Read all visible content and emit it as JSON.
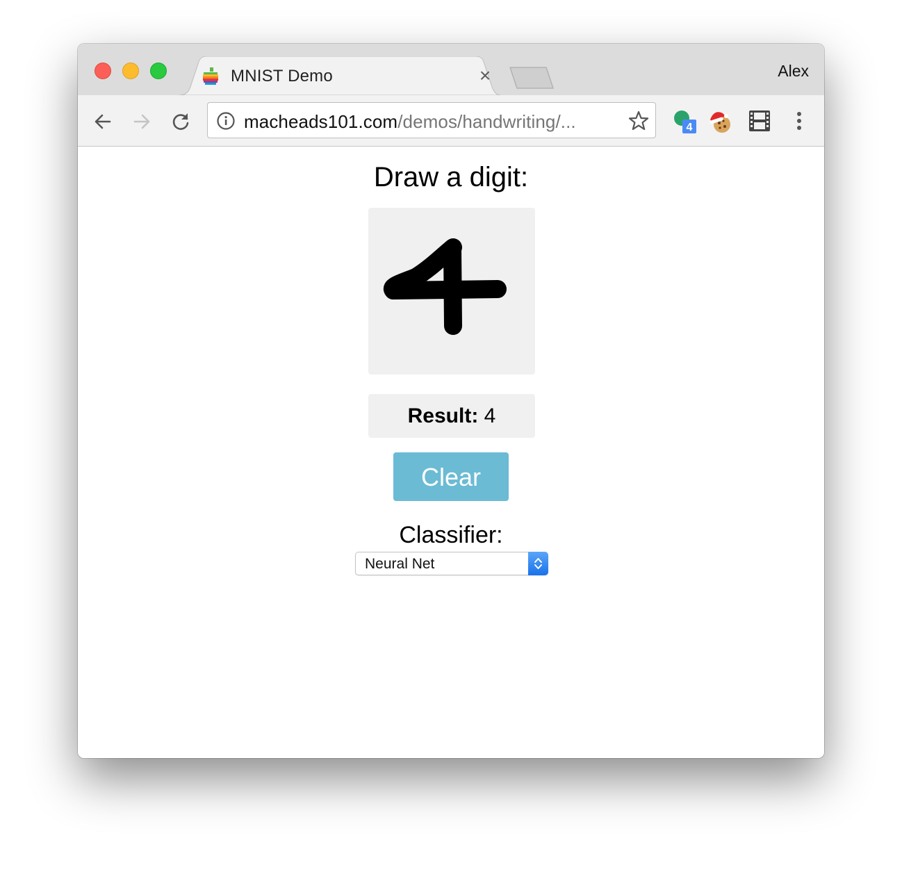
{
  "browser": {
    "tab_title": "MNIST Demo",
    "tab_close": "×",
    "profile_name": "Alex",
    "url_domain": "macheads101.com",
    "url_path": "/demos/handwriting/...",
    "extension_badge": "4"
  },
  "page": {
    "heading": "Draw a digit:",
    "result_label": "Result:",
    "result_value": " 4",
    "clear_label": "Clear",
    "classifier_label": "Classifier:",
    "classifier_selected": "Neural Net"
  },
  "colors": {
    "clear_button": "#6bbbd4",
    "canvas_bg": "#f0f0f0",
    "select_arrow": "#1a72ea"
  }
}
